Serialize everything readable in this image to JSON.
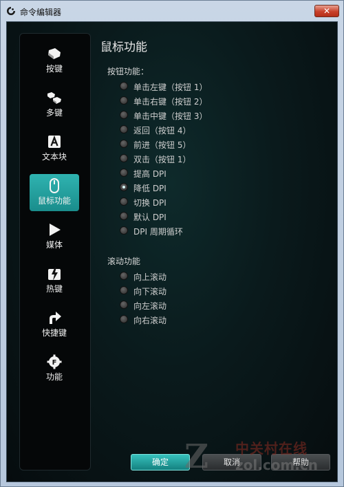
{
  "window": {
    "title": "命令编辑器",
    "close_label": "✕"
  },
  "sidebar": {
    "items": [
      {
        "label": "按键",
        "icon": "key-icon",
        "active": false
      },
      {
        "label": "多键",
        "icon": "multi-key-icon",
        "active": false
      },
      {
        "label": "文本块",
        "icon": "text-block-icon",
        "active": false
      },
      {
        "label": "鼠标功能",
        "icon": "mouse-icon",
        "active": true
      },
      {
        "label": "媒体",
        "icon": "play-icon",
        "active": false
      },
      {
        "label": "热键",
        "icon": "hotkey-icon",
        "active": false
      },
      {
        "label": "快捷键",
        "icon": "shortcut-arrow-icon",
        "active": false
      },
      {
        "label": "功能",
        "icon": "function-gear-icon",
        "active": false
      }
    ]
  },
  "main": {
    "title": "鼠标功能",
    "button_section": {
      "label": "按钮功能：",
      "options": [
        {
          "label": "单击左键（按钮 1）",
          "checked": false
        },
        {
          "label": "单击右键（按钮 2）",
          "checked": false
        },
        {
          "label": "单击中键（按钮 3）",
          "checked": false
        },
        {
          "label": "返回（按钮 4）",
          "checked": false
        },
        {
          "label": "前进（按钮 5）",
          "checked": false
        },
        {
          "label": "双击（按钮 1）",
          "checked": false
        },
        {
          "label": "提高 DPI",
          "checked": false
        },
        {
          "label": "降低 DPI",
          "checked": true
        },
        {
          "label": "切换 DPI",
          "checked": false
        },
        {
          "label": "默认 DPI",
          "checked": false
        },
        {
          "label": "DPI 周期循环",
          "checked": false
        }
      ]
    },
    "scroll_section": {
      "label": "滚动功能",
      "options": [
        {
          "label": "向上滚动",
          "checked": false
        },
        {
          "label": "向下滚动",
          "checked": false
        },
        {
          "label": "向左滚动",
          "checked": false
        },
        {
          "label": "向右滚动",
          "checked": false
        }
      ]
    }
  },
  "footer": {
    "ok_label": "确定",
    "cancel_label": "取消",
    "help_label": "帮助"
  },
  "watermark": {
    "mark": "Z",
    "cn_text": "中关村在线",
    "url_text": "zol.com.cn"
  },
  "colors": {
    "accent": "#22a3a1",
    "background": "#0a1a1c"
  }
}
